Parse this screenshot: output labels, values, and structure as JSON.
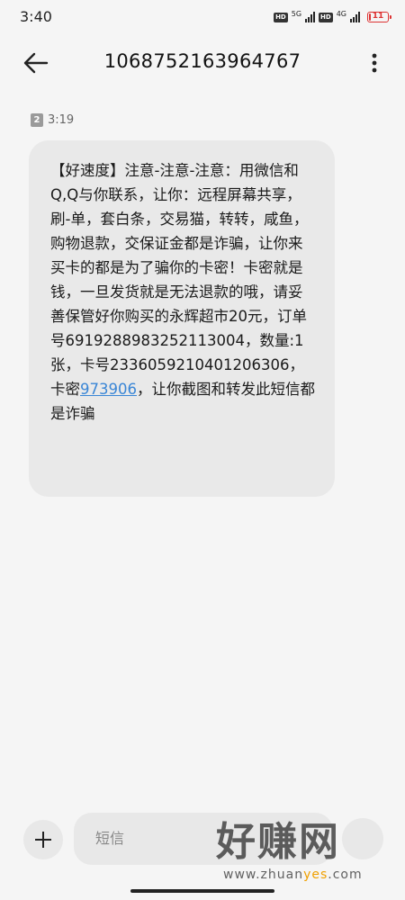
{
  "status_bar": {
    "time": "3:40",
    "hd_1": "HD",
    "net_1": "5G",
    "hd_2": "HD",
    "net_2": "4G",
    "battery": "11",
    "battery_level": 0.11
  },
  "header": {
    "sender": "1068752163964767"
  },
  "message": {
    "sim_slot": "2",
    "time": "3:19",
    "text_before_code": "【好速度】注意-注意-注意：用微信和Q,Q与你联系，让你：远程屏幕共享，刷-单，套白条，交易猫，转转，咸鱼，购物退款，交保证金都是诈骗，让你来买卡的都是为了骗你的卡密！卡密就是钱，一旦发货就是无法退款的哦，请妥善保管好你购买的永辉超市20元，订单号6919288983252113004，数量:1张，卡号2336059210401206306，卡密",
    "code": "973906",
    "text_after_code": "，让你截图和转发此短信都是诈骗"
  },
  "composer": {
    "placeholder": "短信"
  },
  "watermark": {
    "big": "好赚网",
    "url_part1": "www.zhuan",
    "url_highlight": "yes",
    "url_part2": ".com"
  },
  "colors": {
    "background": "#f5f5f5",
    "bubble": "#e9e9e9",
    "link": "#3a86d6",
    "battery_low": "#d33333"
  }
}
